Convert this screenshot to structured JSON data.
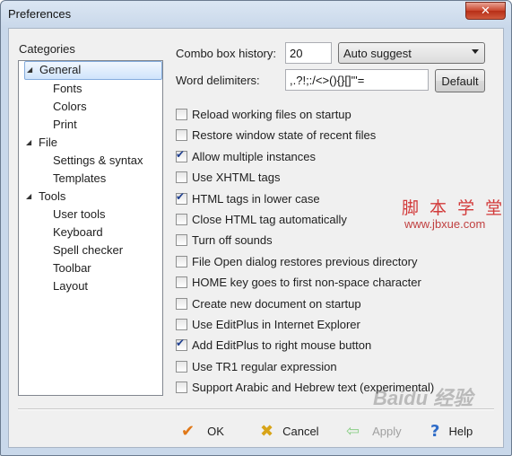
{
  "window": {
    "title": "Preferences",
    "close_label": "✕"
  },
  "categories": {
    "heading": "Categories",
    "items": [
      {
        "label": "General",
        "level": 0,
        "expanded": true,
        "selected": true
      },
      {
        "label": "Fonts",
        "level": 1
      },
      {
        "label": "Colors",
        "level": 1
      },
      {
        "label": "Print",
        "level": 1
      },
      {
        "label": "File",
        "level": 0,
        "expanded": true
      },
      {
        "label": "Settings & syntax",
        "level": 1
      },
      {
        "label": "Templates",
        "level": 1
      },
      {
        "label": "Tools",
        "level": 0,
        "expanded": true
      },
      {
        "label": "User tools",
        "level": 1
      },
      {
        "label": "Keyboard",
        "level": 1
      },
      {
        "label": "Spell checker",
        "level": 1
      },
      {
        "label": "Toolbar",
        "level": 1
      },
      {
        "label": "Layout",
        "level": 1
      }
    ]
  },
  "general": {
    "combo_history_label": "Combo box history:",
    "combo_history_value": "20",
    "auto_suggest_value": "Auto suggest",
    "word_delimiters_label": "Word delimiters:",
    "word_delimiters_value": ",.?!;:/<>(){}[]\"'=",
    "default_button": "Default"
  },
  "options": [
    {
      "label": "Reload working files on startup",
      "checked": false
    },
    {
      "label": "Restore window state of recent files",
      "checked": false
    },
    {
      "label": "Allow multiple instances",
      "checked": true
    },
    {
      "label": "Use XHTML tags",
      "checked": false
    },
    {
      "label": "HTML tags in lower case",
      "checked": true
    },
    {
      "label": "Close HTML tag automatically",
      "checked": false
    },
    {
      "label": "Turn off sounds",
      "checked": false
    },
    {
      "label": "File Open dialog restores previous directory",
      "checked": false
    },
    {
      "label": "HOME key goes to first non-space character",
      "checked": false
    },
    {
      "label": "Create new document on startup",
      "checked": false
    },
    {
      "label": "Use EditPlus in Internet Explorer",
      "checked": false
    },
    {
      "label": "Add EditPlus to right mouse button",
      "checked": true
    },
    {
      "label": "Use TR1 regular expression",
      "checked": false
    },
    {
      "label": "Support Arabic and Hebrew text (experimental)",
      "checked": false
    }
  ],
  "buttons": {
    "ok": "OK",
    "cancel": "Cancel",
    "apply": "Apply",
    "help": "Help"
  },
  "watermark": {
    "site_name": "脚 本 学 堂",
    "site_url": "www.jbxue.com",
    "baidu": "Baidu 经验"
  },
  "colors": {
    "ok_icon": "#e07818",
    "cancel_icon": "#d8a418",
    "apply_icon": "#8ccf88",
    "help_icon": "#2f6cc8",
    "check": "#1f3f8f"
  }
}
